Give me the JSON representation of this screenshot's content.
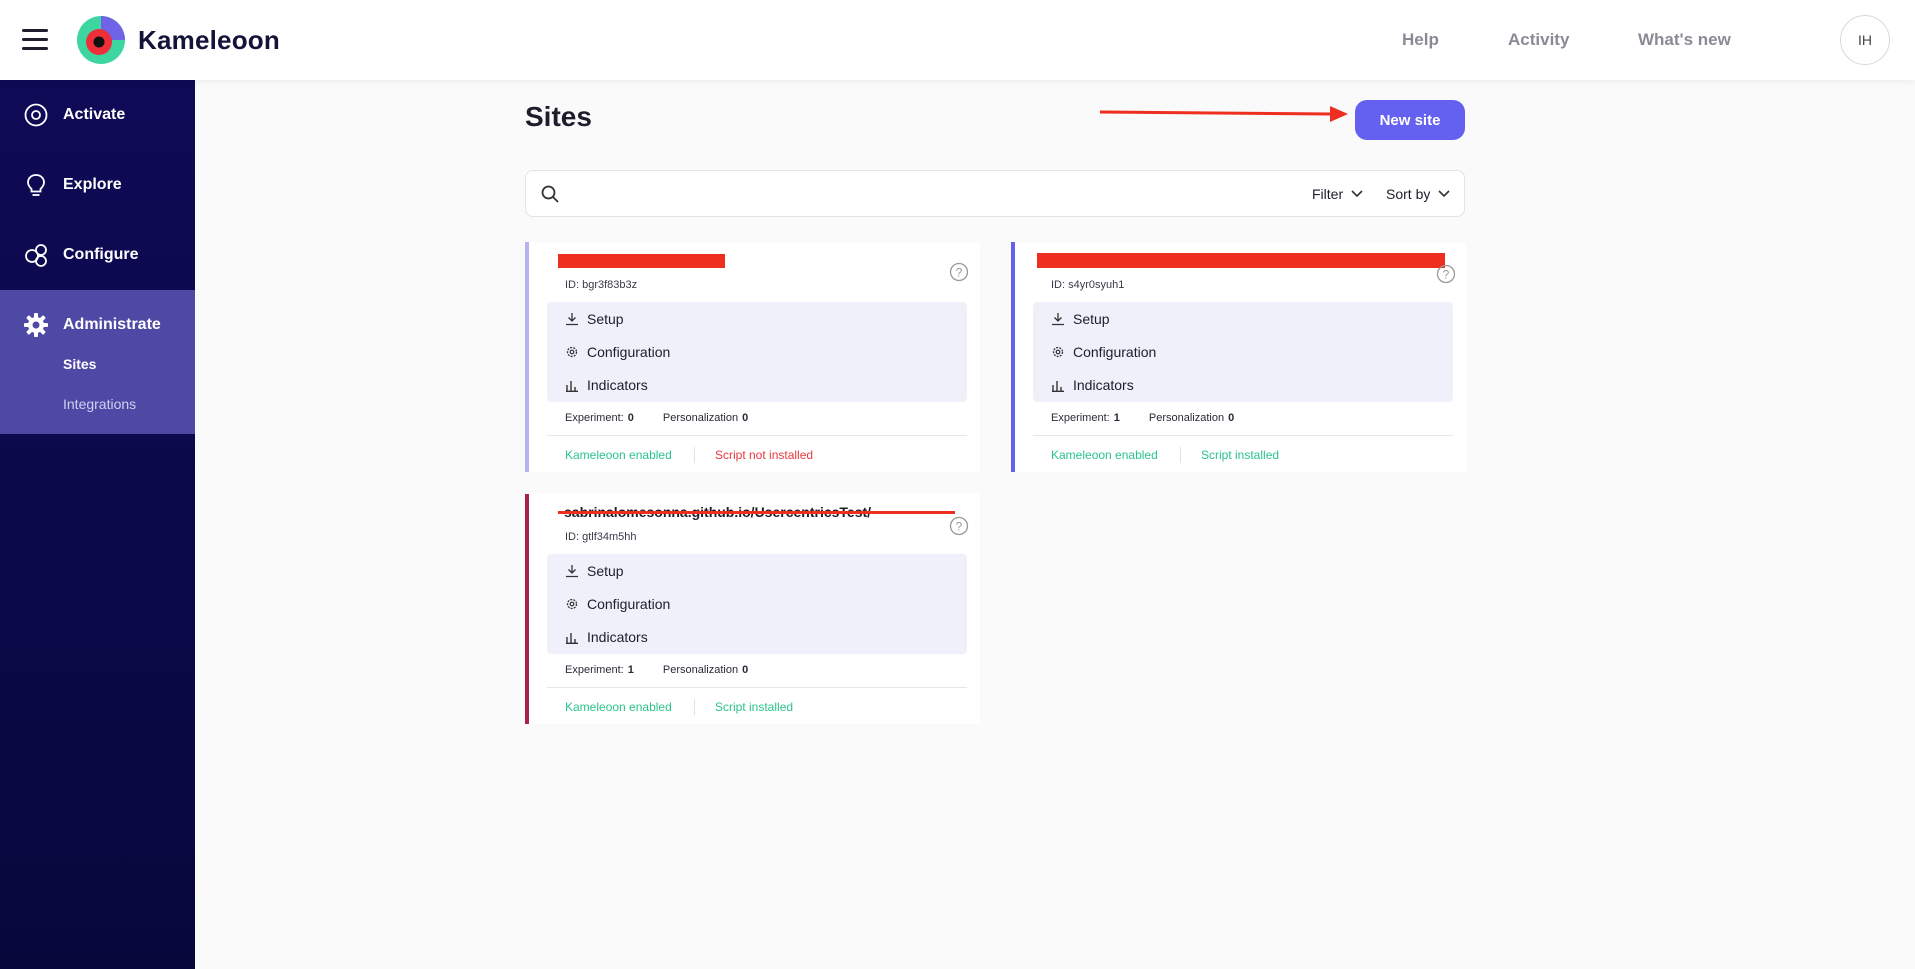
{
  "header": {
    "brand": "Kameleoon",
    "nav": [
      "Help",
      "Activity",
      "What's new"
    ],
    "avatar_initials": "IH"
  },
  "sidebar": {
    "items": [
      {
        "label": "Activate",
        "icon": "target-icon"
      },
      {
        "label": "Explore",
        "icon": "lightbulb-icon"
      },
      {
        "label": "Configure",
        "icon": "circles-icon"
      },
      {
        "label": "Administrate",
        "icon": "gear-icon"
      }
    ],
    "sub_items": [
      "Sites",
      "Integrations"
    ]
  },
  "main": {
    "title": "Sites",
    "new_site_label": "New site",
    "search": {
      "placeholder": ""
    },
    "filter_label": "Filter",
    "sort_label": "Sort by"
  },
  "cards": [
    {
      "name": "",
      "id": "ID: bgr3f83b3z",
      "actions": [
        "Setup",
        "Configuration",
        "Indicators"
      ],
      "experiment_label": "Experiment:",
      "experiment_count": "0",
      "personalization_label": "Personalization",
      "personalization_count": "0",
      "status_enabled": "Kameleoon enabled",
      "status_script": "Script not installed"
    },
    {
      "name": "",
      "id": "ID: s4yr0syuh1",
      "actions": [
        "Setup",
        "Configuration",
        "Indicators"
      ],
      "experiment_label": "Experiment:",
      "experiment_count": "1",
      "personalization_label": "Personalization",
      "personalization_count": "0",
      "status_enabled": "Kameleoon enabled",
      "status_script": "Script installed"
    },
    {
      "name": "sabrinalomesonna.github.io/UsercentricsTest/",
      "id": "ID: gtlf34m5hh",
      "actions": [
        "Setup",
        "Configuration",
        "Indicators"
      ],
      "experiment_label": "Experiment:",
      "experiment_count": "1",
      "personalization_label": "Personalization",
      "personalization_count": "0",
      "status_enabled": "Kameleoon enabled",
      "status_script": "Script installed"
    }
  ],
  "colors": {
    "sidebar_bg": "#0e0a56",
    "admin_active": "#4f49a6",
    "accent": "#6460f0",
    "ok_green": "#2bc48a",
    "error_red": "#e8383d",
    "card1_border": "#b6b4ef",
    "card2_border": "#6460f0",
    "card3_border": "#a8224a",
    "annotation_red": "#ee2f1f"
  }
}
